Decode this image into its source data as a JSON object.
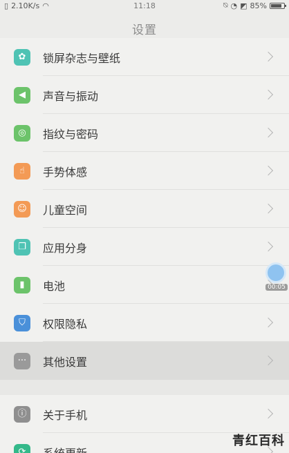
{
  "status_bar": {
    "network_speed": "2.10K/s",
    "time": "11:18",
    "battery_percent": "85%",
    "battery_level": 0.85
  },
  "header": {
    "title": "设置"
  },
  "items": [
    {
      "label": "锁屏杂志与壁纸",
      "icon": "flower-icon",
      "color": "#4fc3b4"
    },
    {
      "label": "声音与振动",
      "icon": "speaker-icon",
      "color": "#6cc36a"
    },
    {
      "label": "指纹与密码",
      "icon": "fingerprint-icon",
      "color": "#6cc36a"
    },
    {
      "label": "手势体感",
      "icon": "hand-icon",
      "color": "#f39a55"
    },
    {
      "label": "儿童空间",
      "icon": "child-icon",
      "color": "#f39a55"
    },
    {
      "label": "应用分身",
      "icon": "clone-icon",
      "color": "#4fc3b4"
    },
    {
      "label": "电池",
      "icon": "battery-icon",
      "color": "#6cc36a"
    },
    {
      "label": "权限隐私",
      "icon": "shield-icon",
      "color": "#4a90d9"
    },
    {
      "label": "其他设置",
      "icon": "more-icon",
      "color": "#9a9a9a"
    },
    {
      "label": "关于手机",
      "icon": "info-icon",
      "color": "#8f8f8f"
    },
    {
      "label": "系统更新",
      "icon": "update-icon",
      "color": "#34b98a"
    }
  ],
  "floating": {
    "time": "00:05"
  },
  "watermark": "青红百科"
}
